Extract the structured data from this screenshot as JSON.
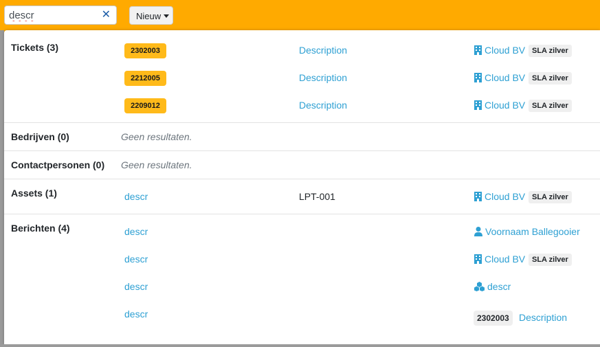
{
  "search": {
    "value": "descr",
    "clear_symbol": "✕"
  },
  "new_button": {
    "label": "Nieuw"
  },
  "sections": {
    "tickets": {
      "title": "Tickets (3)",
      "rows": [
        {
          "number": "2302003",
          "subject": "Description",
          "company": "Cloud BV",
          "sla": "SLA zilver"
        },
        {
          "number": "2212005",
          "subject": "Description",
          "company": "Cloud BV",
          "sla": "SLA zilver"
        },
        {
          "number": "2209012",
          "subject": "Description",
          "company": "Cloud BV",
          "sla": "SLA zilver"
        }
      ]
    },
    "bedrijven": {
      "title": "Bedrijven (0)",
      "empty": "Geen resultaten."
    },
    "contactpersonen": {
      "title": "Contactpersonen (0)",
      "empty": "Geen resultaten."
    },
    "assets": {
      "title": "Assets (1)",
      "rows": [
        {
          "name": "descr",
          "code": "LPT-001",
          "company": "Cloud BV",
          "sla": "SLA zilver"
        }
      ]
    },
    "berichten": {
      "title": "Berichten (4)",
      "rows": [
        {
          "text": "descr",
          "related": "Voornaam Ballegooier",
          "related_icon": "person-icon"
        },
        {
          "text": "descr",
          "related": "Cloud BV",
          "related_icon": "building-icon",
          "sla": "SLA zilver"
        },
        {
          "text": "descr",
          "related": "descr",
          "related_icon": "cubes-icon"
        },
        {
          "text": "descr",
          "ticket_number": "2302003",
          "related": "Description"
        }
      ]
    }
  },
  "colors": {
    "topbar": "#ffaa00",
    "link": "#2ea0d3",
    "ticket_badge": "#ffba1a",
    "badge_gray": "#efefef"
  }
}
